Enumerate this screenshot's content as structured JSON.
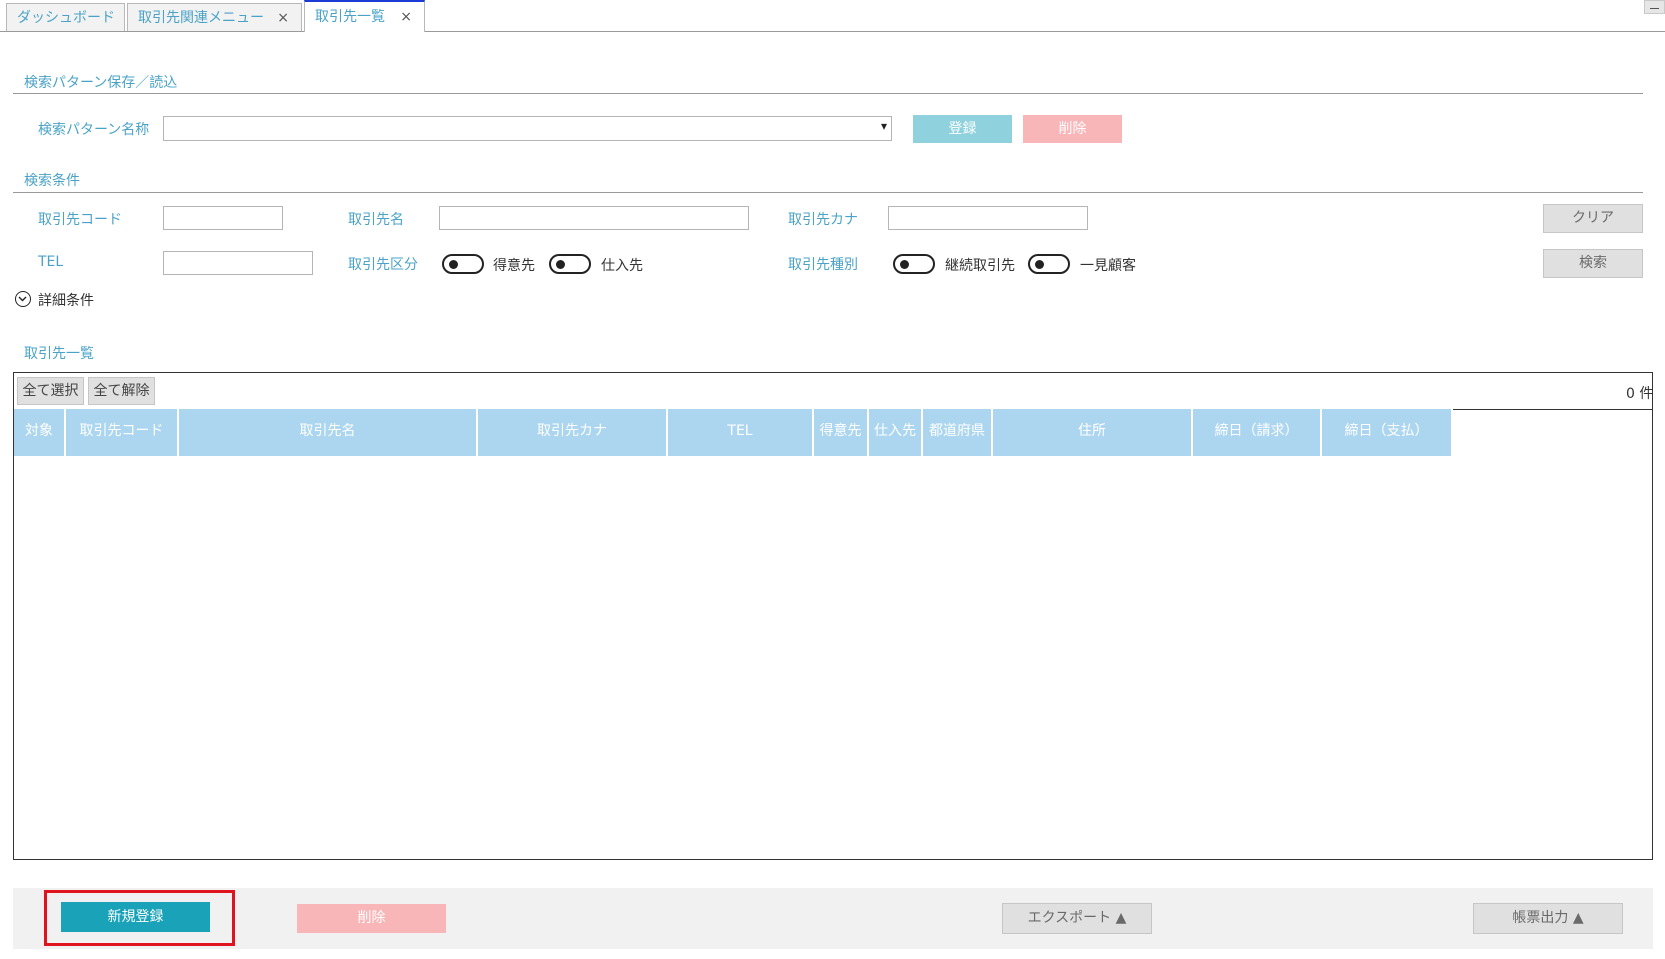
{
  "tabs": [
    {
      "label": "ダッシュボード"
    },
    {
      "label": "取引先関連メニュー",
      "close": "×"
    },
    {
      "label": "取引先一覧",
      "close": "×"
    }
  ],
  "pattern_section": {
    "title": "検索パターン保存／読込",
    "name_label": "検索パターン名称",
    "select_value": "",
    "dropdown_arrow": "▾",
    "register_label": "登録",
    "delete_label": "削除"
  },
  "conditions": {
    "title": "検索条件",
    "code_label": "取引先コード",
    "code_value": "",
    "name_label": "取引先名",
    "name_value": "",
    "kana_label": "取引先カナ",
    "kana_value": "",
    "tel_label": "TEL",
    "tel_value": "",
    "kubun_label": "取引先区分",
    "kubun_options": [
      "得意先",
      "仕入先"
    ],
    "shubetsu_label": "取引先種別",
    "shubetsu_options": [
      "継続取引先",
      "一見顧客"
    ],
    "clear_label": "クリア",
    "search_label": "検索",
    "detail_label": "詳細条件"
  },
  "list": {
    "title": "取引先一覧",
    "select_all": "全て選択",
    "deselect_all": "全て解除",
    "count": "0 件",
    "columns": [
      "対象",
      "取引先コード",
      "取引先名",
      "取引先カナ",
      "TEL",
      "得意先",
      "仕入先",
      "都道府県",
      "住所",
      "締日（請求）",
      "締日（支払）"
    ]
  },
  "footer": {
    "new_label": "新規登録",
    "delete_label": "削除",
    "export_label": "エクスポート ▲",
    "report_label": "帳票出力 ▲"
  },
  "colors": {
    "accent": "#4aa3c7",
    "header_bg": "#acd6ef",
    "primary_button": "#19a2b8",
    "danger_button": "#f8b6b8",
    "highlight_border": "#e0141f"
  }
}
